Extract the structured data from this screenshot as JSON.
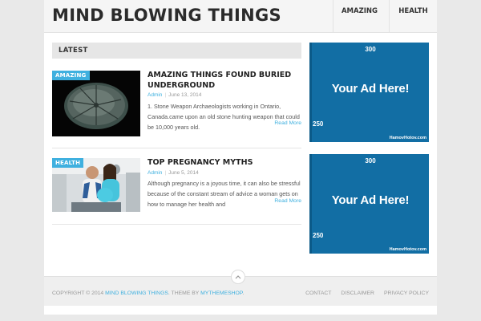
{
  "site": {
    "title": "MIND BLOWING THINGS"
  },
  "nav": {
    "items": [
      {
        "label": "AMAZING"
      },
      {
        "label": "HEALTH"
      }
    ]
  },
  "section": {
    "latest_label": "LATEST"
  },
  "posts": [
    {
      "category": "AMAZING",
      "title": "AMAZING THINGS FOUND BURIED UNDERGROUND",
      "author": "Admin",
      "date": "June 13, 2014",
      "excerpt": "1. Stone Weapon Archaeologists working in Ontario, Canada.came upon an old stone hunting weapon that could be 10,000 years old.",
      "read_more": "Read More"
    },
    {
      "category": "HEALTH",
      "title": "TOP PREGNANCY MYTHS",
      "author": "Admin",
      "date": "June 5, 2014",
      "excerpt": "Although pregnancy is a joyous time, it can also be stressful because of the constant stream of advice a woman gets on how to manage her health and",
      "read_more": "Read More"
    }
  ],
  "ads": [
    {
      "top": "300",
      "main": "Your Ad Here!",
      "left": "250",
      "site": "HamovHotov.com"
    },
    {
      "top": "300",
      "main": "Your Ad Here!",
      "left": "250",
      "site": "HamovHotov.com"
    }
  ],
  "footer": {
    "copyright_prefix": "COPYRIGHT © 2014",
    "copyright_link": "MIND BLOWING THINGS",
    "theme_text": ". THEME BY",
    "theme_link": "MYTHEMESHOP",
    "period": ".",
    "links": [
      {
        "label": "CONTACT"
      },
      {
        "label": "DISCLAIMER"
      },
      {
        "label": "PRIVACY POLICY"
      }
    ]
  },
  "colors": {
    "accent": "#3fb0df",
    "ad_blue": "#126ea4",
    "background": "#e9e9e9"
  }
}
